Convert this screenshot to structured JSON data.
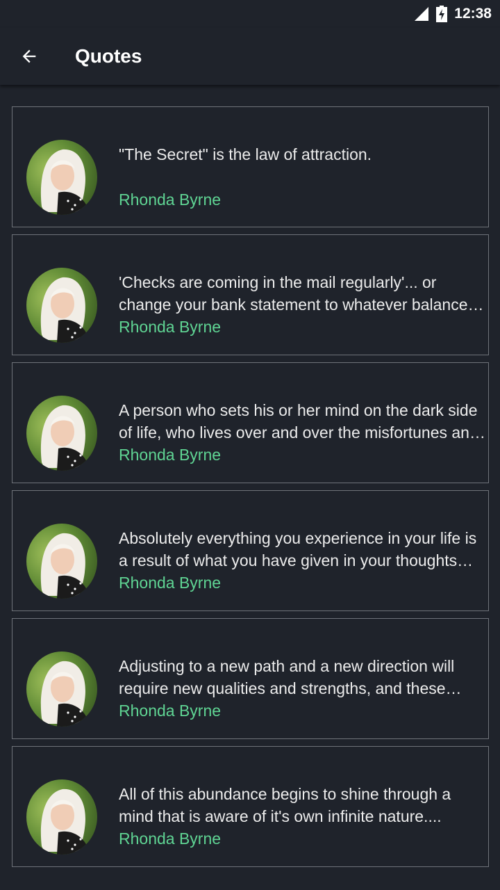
{
  "status_bar": {
    "time": "12:38",
    "signal_icon": "signal-icon",
    "battery_icon": "battery-charging-icon"
  },
  "app_bar": {
    "title": "Quotes",
    "back_icon": "arrow-back-icon"
  },
  "quotes": [
    {
      "text": "\"The Secret\" is the law of attraction.",
      "author": "Rhonda Byrne"
    },
    {
      "text": "'Checks are coming in the mail regularly'... or change your bank statement to whatever balance you want it to be",
      "author": "Rhonda Byrne"
    },
    {
      "text": "A person who sets his or her mind on the dark side of life, who lives over and over the misfortunes and disappointments of the past",
      "author": "Rhonda Byrne"
    },
    {
      "text": "Absolutely everything you experience in your life is a result of what you have given in your thoughts and feelings",
      "author": "Rhonda Byrne"
    },
    {
      "text": "Adjusting to a new path and a new direction will require new qualities and strengths, and these qualities are within you",
      "author": "Rhonda Byrne"
    },
    {
      "text": "All of this abundance begins to shine through a mind that is aware of it's own infinite nature....",
      "author": "Rhonda Byrne"
    }
  ],
  "colors": {
    "background": "#1f232b",
    "author": "#5fd493",
    "card_border": "#6f737a"
  }
}
